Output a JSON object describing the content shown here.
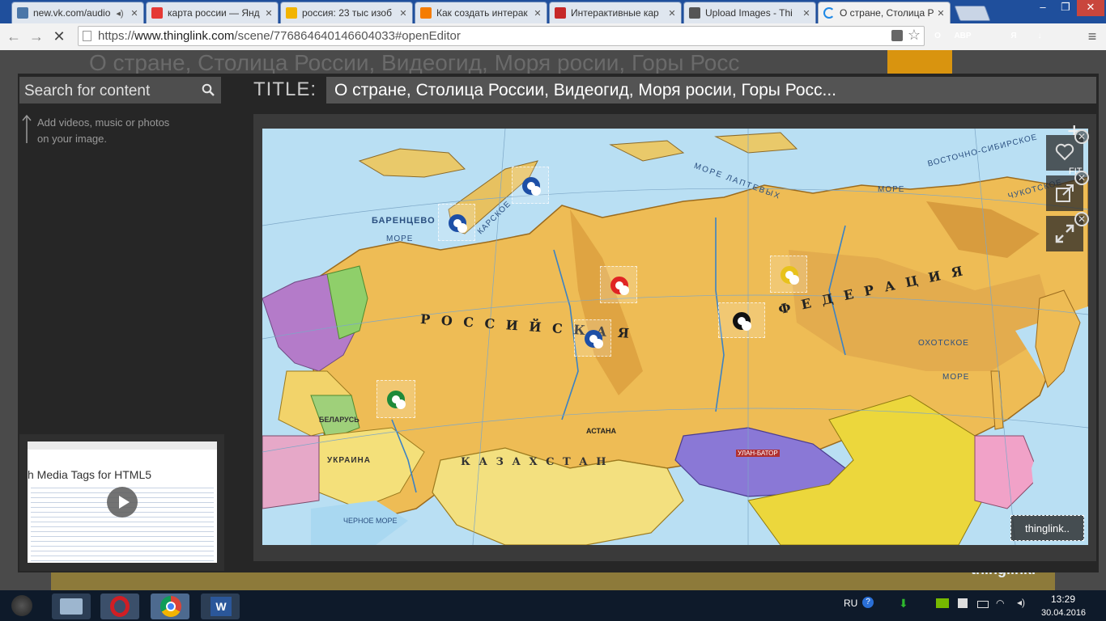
{
  "browser": {
    "tabs": [
      {
        "title": "new.vk.com/audio",
        "favicon_color": "#4a76a8"
      },
      {
        "title": "карта россии — Янд",
        "favicon_color": "#e53935"
      },
      {
        "title": "россия: 23 тыс изоб",
        "favicon_color": "#f2b400"
      },
      {
        "title": "Как создать интерак",
        "favicon_color": "#f57c00"
      },
      {
        "title": "Интерактивные кар",
        "favicon_color": "#c62828"
      },
      {
        "title": "Upload Images - Thi",
        "favicon_color": "#555555"
      },
      {
        "title": "О стране, Столица Р",
        "favicon_color": "#1e88e5"
      }
    ],
    "url_prefix": "https://",
    "url_host": "www.thinglink.com",
    "url_path": "/scene/776864640146604033#openEditor",
    "extensions": [
      {
        "label": "O",
        "color": "#d32f2f"
      },
      {
        "label": "ABP",
        "color": "#c62828"
      },
      {
        "label": "",
        "color": "#e53935"
      },
      {
        "label": "Я",
        "color": "#9e9e9e"
      },
      {
        "label": "↓",
        "color": "#1565c0"
      },
      {
        "label": "",
        "color": "#43a047"
      }
    ]
  },
  "background_page": {
    "title": "О стране, Столица России, Видеогид, Моря росии, Горы Росс",
    "footer_brand": "thinglink."
  },
  "editor": {
    "search_placeholder": "Search for content",
    "hint": "Add videos, music or photos on your image.",
    "media_thumb_title": "h Media Tags for HTML5",
    "title_label": "TITLE:",
    "title_value": "О стране, Столица России, Видеогид, Моря росии, Горы Росс...",
    "fit_label": "FIT",
    "brand_badge": "thinglink..",
    "pins": [
      {
        "name": "pin-novaya-zemlya",
        "color": "#1d4fa6"
      },
      {
        "name": "pin-kara-sea",
        "color": "#1d4fa6"
      },
      {
        "name": "pin-west-siberia",
        "color": "#e02424"
      },
      {
        "name": "pin-yakutia",
        "color": "#e8c21c"
      },
      {
        "name": "pin-central-siberia",
        "color": "#111111"
      },
      {
        "name": "pin-urals",
        "color": "#1d4fa6"
      },
      {
        "name": "pin-moscow",
        "color": "#1e8a3a"
      }
    ],
    "map_labels": {
      "country": "Р О С С И Й С К А Я",
      "federation": "Ф Е Д Е Р А Ц И Я",
      "kazakhstan": "К А З А Х С Т А Н",
      "barents": "БАРЕНЦЕВО",
      "more1": "МОРЕ",
      "kara": "КАРСКОЕ",
      "laptev": "МОРЕ ЛАПТЕВЫХ",
      "east_sib": "ВОСТОЧНО-СИБИРСКОЕ",
      "more2": "МОРЕ",
      "okhotsk": "ОХОТСКОЕ",
      "more3": "МОРЕ",
      "chukotka": "ЧУКОТСКОЕ",
      "ukraine": "УКРАИНА",
      "belarus": "БЕЛАРУСЬ",
      "black_sea": "ЧЕРНОЕ МОРЕ",
      "astana": "АСТАНА",
      "ulaanbaatar": "УЛАН-БАТОР"
    }
  },
  "taskbar": {
    "lang": "RU",
    "time": "13:29",
    "date": "30.04.2016"
  }
}
